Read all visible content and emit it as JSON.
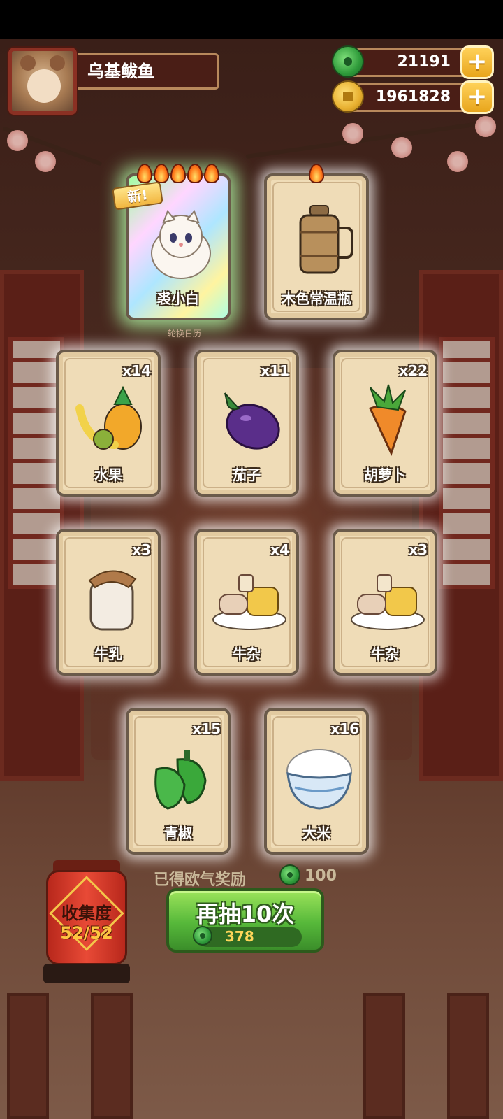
{
  "player": {
    "name": "乌基鲅鱼"
  },
  "currency": {
    "jade": "21191",
    "coins": "1961828",
    "jade_icon": "jade-icon",
    "coin_icon": "coin-icon",
    "plus_label": "+"
  },
  "featured": [
    {
      "name": "裘小白",
      "flames": 5,
      "is_new": true,
      "new_label": "新!",
      "icon": "white-cat-icon"
    },
    {
      "name": "木色常温瓶",
      "flames": 1,
      "is_new": false,
      "icon": "wooden-flask-icon"
    }
  ],
  "featured_caption": "轮换日历",
  "cards": [
    {
      "name": "水果",
      "count": "x14",
      "icon": "fruit-icon"
    },
    {
      "name": "茄子",
      "count": "x11",
      "icon": "eggplant-icon"
    },
    {
      "name": "胡萝卜",
      "count": "x22",
      "icon": "carrot-icon"
    },
    {
      "name": "牛乳",
      "count": "x3",
      "icon": "milk-jar-icon"
    },
    {
      "name": "牛杂",
      "count": "x4",
      "icon": "beef-offal-icon"
    },
    {
      "name": "牛杂",
      "count": "x3",
      "icon": "beef-offal-icon"
    },
    {
      "name": "青椒",
      "count": "x15",
      "icon": "green-pepper-icon"
    },
    {
      "name": "大米",
      "count": "x16",
      "icon": "rice-bowl-icon"
    }
  ],
  "reward": {
    "text": "已得欧气奖励",
    "amount": "100"
  },
  "collection": {
    "title": "收集度",
    "progress": "52/52"
  },
  "draw_button": {
    "label": "再抽10次",
    "cost": "378"
  },
  "colors": {
    "accent_green": "#56b83a",
    "gold": "#e8a51c",
    "wood": "#4a1e16"
  }
}
